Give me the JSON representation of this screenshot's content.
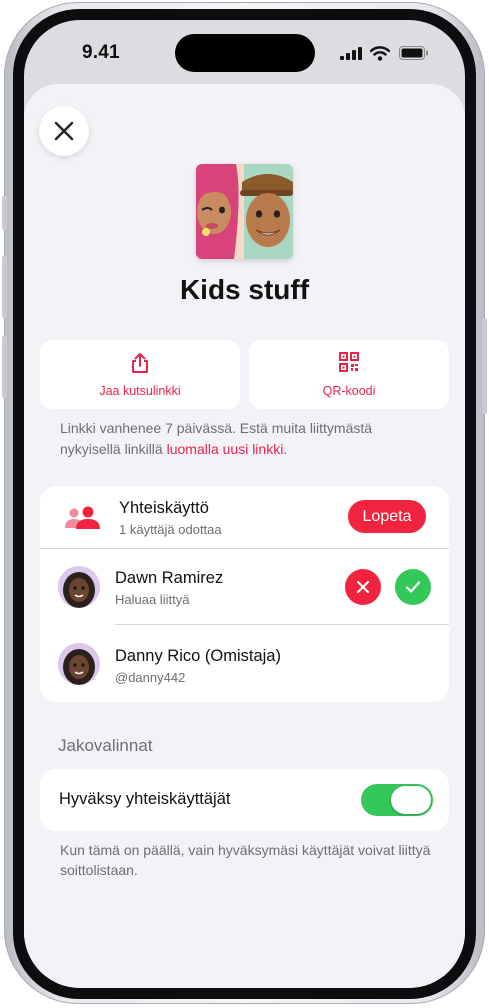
{
  "status_bar": {
    "time": "9.41"
  },
  "playlist": {
    "title": "Kids stuff"
  },
  "actions": {
    "share_link_label": "Jaa kutsulinkki",
    "qr_label": "QR-koodi"
  },
  "link_note": {
    "text": "Linkki vanhenee 7 päivässä. Estä muita liittymästä nykyisellä linkillä ",
    "link_text": "luomalla uusi linkki",
    "suffix": "."
  },
  "collaboration": {
    "title": "Yhteiskäyttö",
    "subtitle": "1 käyttäjä odottaa",
    "stop_label": "Lopeta",
    "members": [
      {
        "name": "Dawn Ramirez",
        "status": "Haluaa liittyä"
      },
      {
        "name": "Danny Rico (Omistaja)",
        "status": "@danny442"
      }
    ]
  },
  "share_options": {
    "header": "Jakovalinnat",
    "approve_label": "Hyväksy yhteiskäyttäjät",
    "approve_on": true,
    "footnote": "Kun tämä on päällä, vain hyväksymäsi käyttäjät voivat liittyä soittolistaan."
  },
  "colors": {
    "accent": "#e8244d",
    "stop": "#f0243f",
    "decline": "#f0243f",
    "accept": "#34c759",
    "toggle_on": "#34c759"
  },
  "icons": {
    "close": "close-icon",
    "share": "share-icon",
    "qr": "qr-code-icon",
    "people": "people-icon",
    "decline": "x-icon",
    "accept": "checkmark-icon"
  }
}
